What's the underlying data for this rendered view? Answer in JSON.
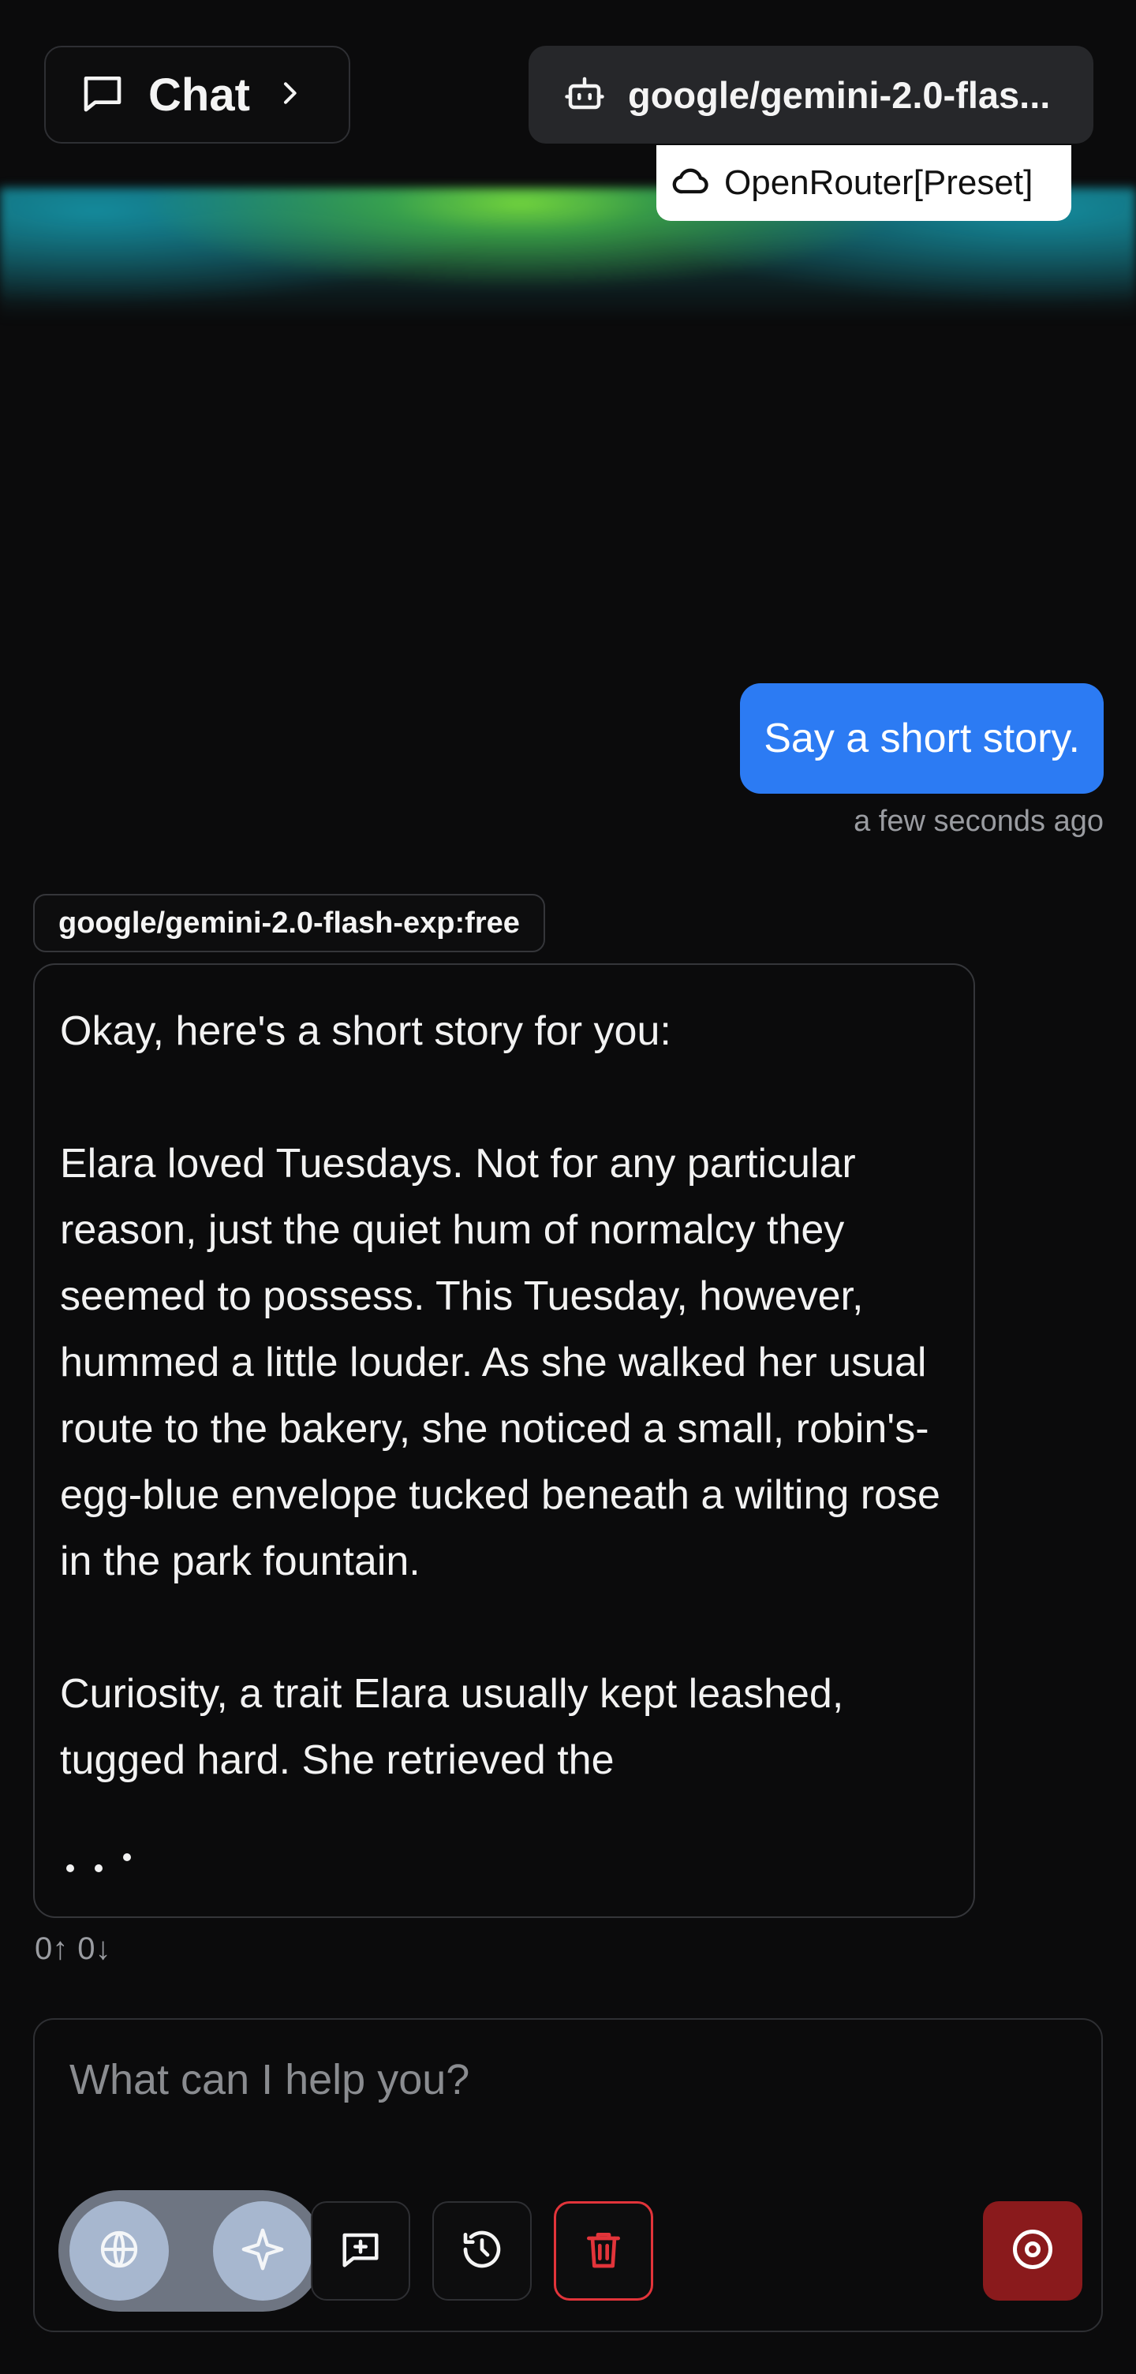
{
  "header": {
    "chat_label": "Chat",
    "model_label": "google/gemini-2.0-flas...",
    "preset_label": "OpenRouter[Preset]"
  },
  "user_message": {
    "text": "Say a short story.",
    "time": "a few seconds ago"
  },
  "assistant_message": {
    "model": "google/gemini-2.0-flash-exp:free",
    "paragraphs": [
      "Okay, here's a short story for you:",
      "Elara loved Tuesdays. Not for any particular reason, just the quiet hum of normalcy they seemed to possess. This Tuesday, however, hummed a little louder. As she walked her usual route to the bakery, she noticed a small, robin's-egg-blue envelope tucked beneath a wilting rose in the park fountain.",
      "Curiosity, a trait Elara usually kept leashed, tugged hard. She retrieved the"
    ],
    "tokens_up": "0↑",
    "tokens_down": "0↓"
  },
  "composer": {
    "placeholder": "What can I help you?",
    "value": ""
  },
  "colors": {
    "background": "#0b0b0c",
    "user_bubble": "#2c7bf3",
    "stop_button": "#8a1a1c",
    "delete_border": "#e2343a",
    "pill": "#6e7582",
    "pill_circle": "#a7b7cf"
  },
  "icons": {
    "chat": "message-square-icon",
    "chevron": "chevron-right-icon",
    "model": "bot-icon",
    "preset": "cloud-icon",
    "web": "globe-icon",
    "magic": "sparkle-icon",
    "new_chat": "message-plus-icon",
    "history": "history-icon",
    "delete": "trash-icon",
    "stop": "stop-circle-icon"
  }
}
